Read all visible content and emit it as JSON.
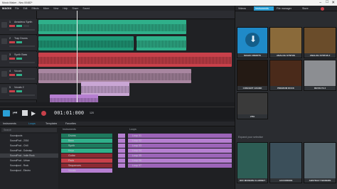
{
  "window": {
    "title": "Music Maker - Neu 00482*"
  },
  "menu": [
    "File",
    "Edit",
    "Effects",
    "Mixer",
    "View",
    "Help",
    "Share",
    "Sound"
  ],
  "logo": "MAGIX",
  "tracks": [
    {
      "num": "1",
      "name": "Amadeus Synth"
    },
    {
      "num": "2",
      "name": "Trap Drums"
    },
    {
      "num": "3",
      "name": "Synth Bass"
    },
    {
      "num": "4",
      "name": "Vocals"
    },
    {
      "num": "5",
      "name": "Vocals 2"
    }
  ],
  "transport": {
    "time": "001:01:000",
    "tempo": "120"
  },
  "lower": {
    "tabs": [
      "Instruments",
      "Loops",
      "Templates",
      "Favorites"
    ],
    "search_placeholder": "Search",
    "sidebar": [
      "Soundpools",
      "SoundPool - 2016",
      "SoundPool - Chill",
      "SoundPool - Dubstep",
      "SoundPool - Indie Rock",
      "SoundPool - Urban",
      "Soundpool - Rock",
      "Soundpool - Electro"
    ],
    "instruments_header": "Instruments",
    "instruments": [
      "Drums",
      "Bass",
      "Synth",
      "Keys",
      "Guitar",
      "Pads",
      "Sequences",
      "Vocals"
    ],
    "loops_header": "Loops",
    "loops": [
      "Loop 01",
      "Loop 02",
      "Loop 03",
      "Loop 04",
      "Loop 05",
      "Loop 06",
      "Loop 07"
    ],
    "results": [
      "Loop result 01",
      "Loop result 02",
      "Loop result 03"
    ]
  },
  "right": {
    "tabs": [
      "Videos",
      "Instruments",
      "File manager",
      "Store"
    ],
    "store_label": "Expand your selection",
    "instrument_tiles": [
      {
        "caption": "MAGIX CREDITS",
        "color": "#1f8ac8"
      },
      {
        "caption": "ANALOG SYNTHS",
        "color": "#8a6a3a"
      },
      {
        "caption": "ANALOG SYNTHS 2",
        "color": "#6a4c2a"
      },
      {
        "caption": "CONCERT GRAND",
        "color": "#241a14"
      },
      {
        "caption": "PREMIUM ROCK",
        "color": "#4a2a1a"
      },
      {
        "caption": "REVOLTA 2",
        "color": "#8c8e92"
      },
      {
        "caption": "VITA",
        "color": "#3a3a3a"
      }
    ],
    "store_tiles": [
      {
        "caption": "OFF MODERN CLARINET",
        "color": "#2d5d55"
      },
      {
        "caption": "ACCORDION",
        "color": "#3b4f5a"
      },
      {
        "caption": "ABSTRACT MODERN",
        "color": "#55656d"
      }
    ]
  },
  "colors": {
    "green": "#2fb08a",
    "greenDark": "#1e7a5e",
    "red": "#c8404a",
    "redDark": "#8c2a33",
    "purple": "#b67fd1",
    "mauve": "#a886a0",
    "accent": "#2a9fd6"
  }
}
